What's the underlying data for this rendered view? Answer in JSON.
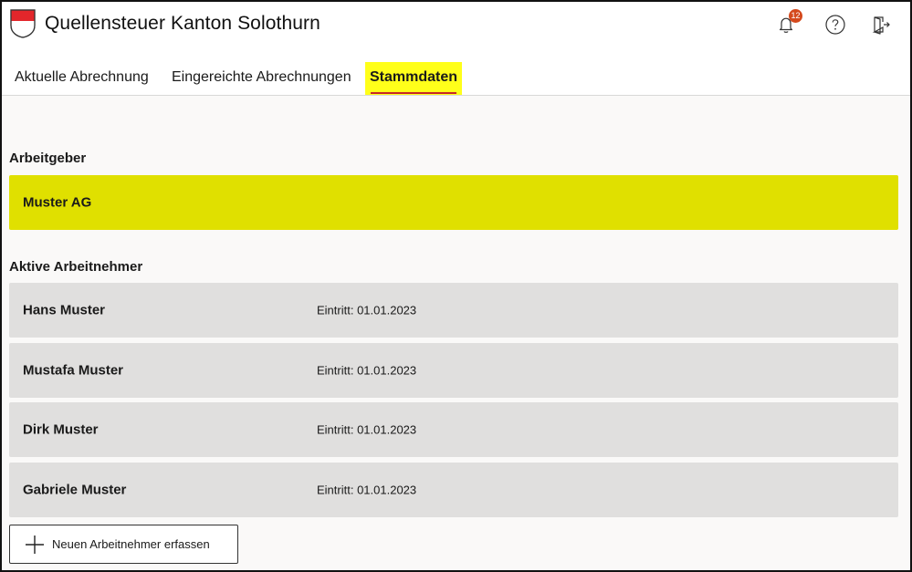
{
  "header": {
    "title": "Quellensteuer Kanton Solothurn",
    "notifications_count": "12",
    "icons": [
      "crest-icon",
      "bell-icon",
      "help-icon",
      "logout-icon"
    ]
  },
  "tabs": [
    {
      "label": "Aktuelle Abrechnung",
      "active": false
    },
    {
      "label": "Eingereichte Abrechnungen",
      "active": false
    },
    {
      "label": "Stammdaten",
      "active": true
    }
  ],
  "employer_section": {
    "title": "Arbeitgeber",
    "employer": "Muster AG"
  },
  "employees_section": {
    "title": "Aktive Arbeitnehmer",
    "employees": [
      {
        "name": "Hans Muster",
        "entry": "Eintritt: 01.01.2023"
      },
      {
        "name": "Mustafa Muster",
        "entry": "Eintritt: 01.01.2023"
      },
      {
        "name": "Dirk Muster",
        "entry": "Eintritt: 01.01.2023"
      },
      {
        "name": "Gabriele Muster",
        "entry": "Eintritt: 01.01.2023"
      }
    ]
  },
  "add_button": {
    "label": "Neuen Arbeitnehmer erfassen"
  },
  "colors": {
    "active_tab_bg": "#ffff1a",
    "active_tab_underline": "#c62828",
    "employer_card": "#e0e000",
    "employee_card": "#e0dfde",
    "badge": "#d4491d"
  }
}
